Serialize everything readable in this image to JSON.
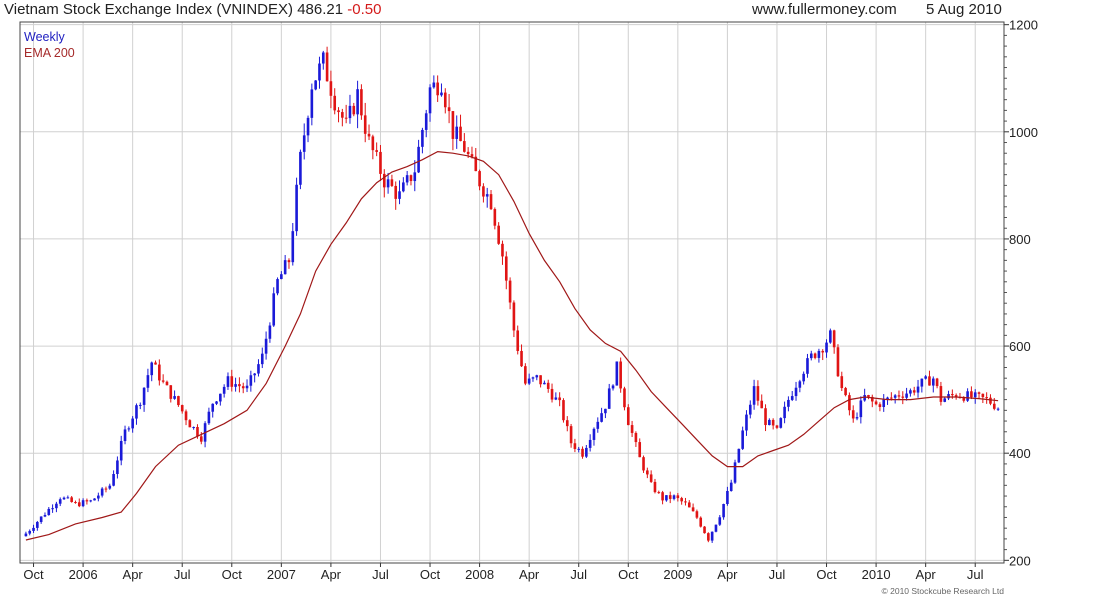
{
  "header": {
    "title": "Vietnam Stock Exchange Index (VNINDEX)",
    "last": "486.21",
    "change": "-0.50",
    "source": "www.fullermoney.com",
    "date": "5 Aug 2010"
  },
  "legend": {
    "weekly": "Weekly",
    "ema": "EMA 200"
  },
  "copyright": "© 2010 Stockcube Research Ltd",
  "colors": {
    "up": "#1a1ad8",
    "down": "#e01414",
    "ema": "#a01818",
    "grid": "#d0d0d0"
  },
  "chart_data": {
    "type": "line",
    "title": "Vietnam Stock Exchange Index (VNINDEX)",
    "y_axis_position": "right",
    "ylim": [
      195,
      1205
    ],
    "y_ticks": [
      200,
      400,
      600,
      800,
      1000,
      1200
    ],
    "x_ticks": [
      {
        "label": "Oct",
        "week": 2
      },
      {
        "label": "2006",
        "week": 15
      },
      {
        "label": "Apr",
        "week": 28
      },
      {
        "label": "Jul",
        "week": 41
      },
      {
        "label": "Oct",
        "week": 54
      },
      {
        "label": "2007",
        "week": 67
      },
      {
        "label": "Apr",
        "week": 80
      },
      {
        "label": "Jul",
        "week": 93
      },
      {
        "label": "Oct",
        "week": 106
      },
      {
        "label": "2008",
        "week": 119
      },
      {
        "label": "Apr",
        "week": 132
      },
      {
        "label": "Jul",
        "week": 145
      },
      {
        "label": "Oct",
        "week": 158
      },
      {
        "label": "2009",
        "week": 171
      },
      {
        "label": "Apr",
        "week": 184
      },
      {
        "label": "Jul",
        "week": 197
      },
      {
        "label": "Oct",
        "week": 210
      },
      {
        "label": "2010",
        "week": 223
      },
      {
        "label": "Apr",
        "week": 236
      },
      {
        "label": "Jul",
        "week": 249
      }
    ],
    "series": [
      {
        "name": "Weekly",
        "style": "candlestick",
        "close_points": [
          [
            0,
            250
          ],
          [
            4,
            280
          ],
          [
            9,
            318
          ],
          [
            13,
            305
          ],
          [
            17,
            310
          ],
          [
            22,
            340
          ],
          [
            26,
            440
          ],
          [
            30,
            500
          ],
          [
            33,
            570
          ],
          [
            36,
            530
          ],
          [
            40,
            490
          ],
          [
            43,
            455
          ],
          [
            46,
            430
          ],
          [
            49,
            495
          ],
          [
            53,
            535
          ],
          [
            58,
            520
          ],
          [
            62,
            580
          ],
          [
            66,
            720
          ],
          [
            69,
            760
          ],
          [
            72,
            950
          ],
          [
            75,
            1090
          ],
          [
            78,
            1130
          ],
          [
            81,
            1060
          ],
          [
            84,
            1010
          ],
          [
            87,
            1070
          ],
          [
            90,
            980
          ],
          [
            94,
            910
          ],
          [
            98,
            880
          ],
          [
            102,
            930
          ],
          [
            106,
            1080
          ],
          [
            109,
            1095
          ],
          [
            112,
            1000
          ],
          [
            115,
            970
          ],
          [
            118,
            920
          ],
          [
            122,
            870
          ],
          [
            125,
            770
          ],
          [
            128,
            630
          ],
          [
            131,
            530
          ],
          [
            134,
            540
          ],
          [
            137,
            520
          ],
          [
            140,
            490
          ],
          [
            143,
            420
          ],
          [
            146,
            400
          ],
          [
            149,
            450
          ],
          [
            152,
            490
          ],
          [
            155,
            560
          ],
          [
            158,
            460
          ],
          [
            161,
            390
          ],
          [
            164,
            340
          ],
          [
            167,
            315
          ],
          [
            170,
            318
          ],
          [
            173,
            305
          ],
          [
            176,
            280
          ],
          [
            179,
            240
          ],
          [
            182,
            285
          ],
          [
            185,
            345
          ],
          [
            188,
            440
          ],
          [
            191,
            520
          ],
          [
            194,
            460
          ],
          [
            197,
            440
          ],
          [
            200,
            500
          ],
          [
            203,
            545
          ],
          [
            206,
            580
          ],
          [
            209,
            600
          ],
          [
            211,
            620
          ],
          [
            214,
            520
          ],
          [
            217,
            460
          ],
          [
            220,
            505
          ],
          [
            223,
            490
          ],
          [
            226,
            500
          ],
          [
            229,
            510
          ],
          [
            232,
            515
          ],
          [
            235,
            530
          ],
          [
            238,
            540
          ],
          [
            240,
            500
          ],
          [
            244,
            510
          ],
          [
            248,
            505
          ],
          [
            252,
            500
          ],
          [
            255,
            486
          ]
        ]
      },
      {
        "name": "EMA 200",
        "style": "line",
        "points": [
          [
            0,
            238
          ],
          [
            6,
            248
          ],
          [
            13,
            268
          ],
          [
            20,
            280
          ],
          [
            25,
            290
          ],
          [
            29,
            325
          ],
          [
            34,
            375
          ],
          [
            40,
            415
          ],
          [
            46,
            435
          ],
          [
            52,
            455
          ],
          [
            58,
            480
          ],
          [
            63,
            530
          ],
          [
            68,
            600
          ],
          [
            72,
            660
          ],
          [
            76,
            740
          ],
          [
            80,
            790
          ],
          [
            84,
            830
          ],
          [
            88,
            875
          ],
          [
            92,
            905
          ],
          [
            96,
            925
          ],
          [
            100,
            935
          ],
          [
            104,
            948
          ],
          [
            108,
            963
          ],
          [
            112,
            960
          ],
          [
            116,
            955
          ],
          [
            120,
            945
          ],
          [
            124,
            920
          ],
          [
            128,
            870
          ],
          [
            132,
            810
          ],
          [
            136,
            760
          ],
          [
            140,
            720
          ],
          [
            144,
            670
          ],
          [
            148,
            630
          ],
          [
            152,
            605
          ],
          [
            156,
            590
          ],
          [
            160,
            555
          ],
          [
            164,
            515
          ],
          [
            168,
            485
          ],
          [
            172,
            455
          ],
          [
            176,
            425
          ],
          [
            180,
            395
          ],
          [
            184,
            375
          ],
          [
            188,
            375
          ],
          [
            192,
            395
          ],
          [
            196,
            405
          ],
          [
            200,
            415
          ],
          [
            204,
            435
          ],
          [
            208,
            460
          ],
          [
            212,
            485
          ],
          [
            216,
            500
          ],
          [
            220,
            505
          ],
          [
            226,
            500
          ],
          [
            232,
            500
          ],
          [
            238,
            505
          ],
          [
            244,
            505
          ],
          [
            250,
            502
          ],
          [
            255,
            498
          ]
        ]
      }
    ]
  }
}
